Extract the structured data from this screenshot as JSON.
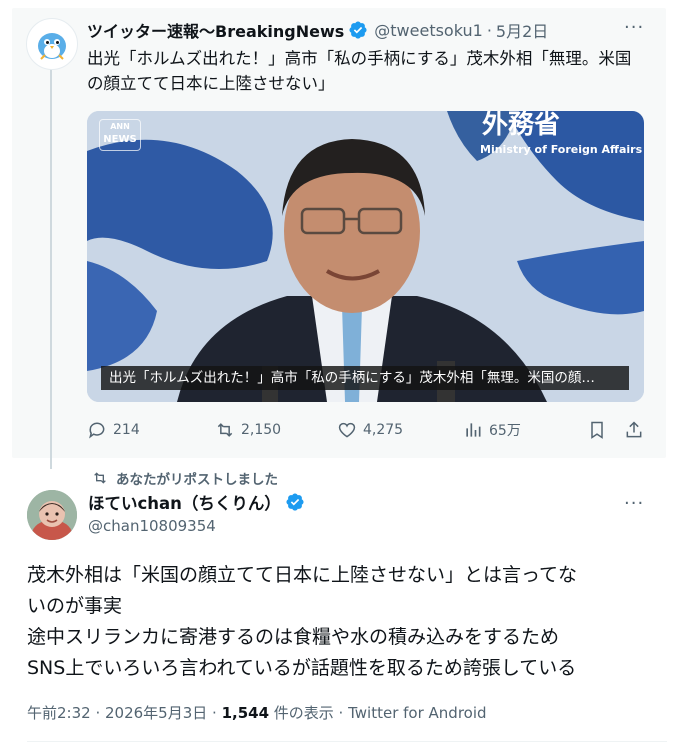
{
  "quoted_tweet": {
    "name": "ツイッター速報〜BreakingNews",
    "handle": "@tweetsoku1",
    "date": "5月2日",
    "text": "出光「ホルムズ出れた！」高市「私の手柄にする」茂木外相「無理。米国の顔立てて日本に上陸させない」",
    "media": {
      "watermark_top": "ANN",
      "watermark_bottom": "NEWS",
      "sign_text": "外務省",
      "sign_sub": "Ministry of Foreign Affairs of J",
      "caption": "出光「ホルムズ出れた！」高市「私の手柄にする」茂木外相「無理。米国の顔…"
    },
    "stats": {
      "replies": "214",
      "reposts": "2,150",
      "likes": "4,275",
      "views": "65万"
    }
  },
  "repost_note": "あなたがリポストしました",
  "main_tweet": {
    "name": "ほていchan（ちくりん）",
    "handle": "@chan10809354",
    "lines": [
      "茂木外相は「米国の顔立てて日本に上陸させない」とは言ってな",
      "いのが事実",
      "途中スリランカに寄港するのは食糧や水の積み込みをするため",
      "SNS上でいろいろ言われているが話題性を取るため誇張している"
    ],
    "meta_time": "午前2:32 · 2026年5月3日 · ",
    "meta_views": "1,544",
    "meta_views_label": " 件の表示 · ",
    "meta_client": "Twitter for Android"
  },
  "colors": {
    "verified": "#1d9bf0",
    "muted": "#536471",
    "text": "#0f1419"
  }
}
